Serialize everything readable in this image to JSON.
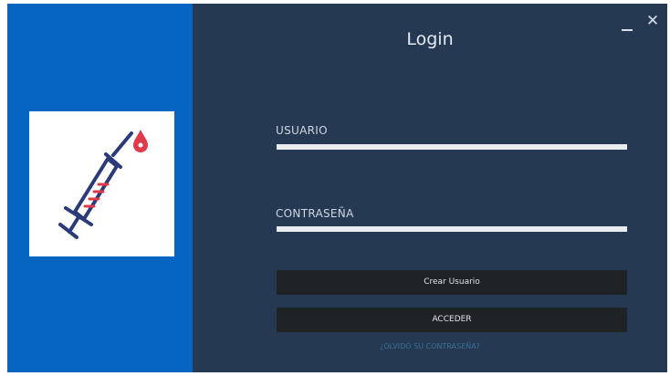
{
  "window": {
    "title": "Login",
    "minimize_label": "",
    "close_label": "✕"
  },
  "logo": {
    "icon": "syringe-icon",
    "colors": {
      "line": "#2b3a78",
      "accent": "#e0394a"
    }
  },
  "form": {
    "username_label": "USUARIO",
    "username_value": "",
    "password_label": "CONTRASEÑA",
    "password_value": "",
    "create_user_label": "Crear Usuario",
    "access_label": "ACCEDER",
    "forgot_label": "¿OLVIDÓ SU CONTRASEÑA?"
  },
  "colors": {
    "left_panel": "#0565c1",
    "right_panel": "#253952",
    "button": "#1f2326",
    "input": "#e9ecef"
  }
}
